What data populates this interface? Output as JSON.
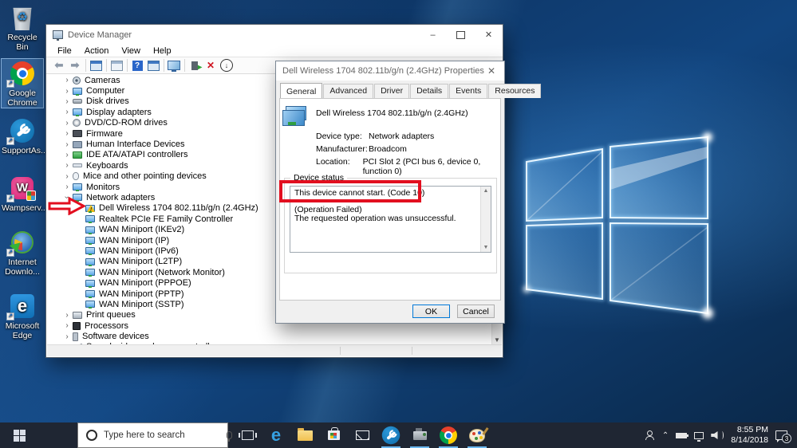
{
  "desktop": {
    "icons": [
      {
        "name": "recycle-bin-icon",
        "label": "Recycle Bin",
        "type": "recycle",
        "sel": "",
        "shortcut": false
      },
      {
        "name": "google-chrome-icon",
        "label": "Google Chrome",
        "type": "chrome",
        "sel": "selected",
        "shortcut": true
      },
      {
        "name": "supportassist-icon",
        "label": "SupportAs...",
        "type": "sa",
        "sel": "",
        "shortcut": true
      },
      {
        "name": "wampserver-icon",
        "label": "Wampserv...",
        "type": "wamp",
        "sel": "",
        "shortcut": true
      },
      {
        "name": "internet-download-manager-icon",
        "label": "Internet Downlo...",
        "type": "idm",
        "sel": "",
        "shortcut": true
      },
      {
        "name": "microsoft-edge-icon",
        "label": "Microsoft Edge",
        "type": "edge",
        "sel": "",
        "shortcut": true
      }
    ]
  },
  "device_manager": {
    "title": "Device Manager",
    "menus": [
      {
        "label": "File"
      },
      {
        "label": "Action"
      },
      {
        "label": "View"
      },
      {
        "label": "Help"
      }
    ],
    "toolbar": [
      {
        "name": "back-icon",
        "type": "tb-back"
      },
      {
        "name": "forward-icon",
        "type": "tb-fwd"
      },
      {
        "name": "toolbar-separator",
        "type": "tb-sep"
      },
      {
        "name": "show-console-tree-icon",
        "type": "tb-win"
      },
      {
        "name": "toolbar-separator",
        "type": "tb-sep"
      },
      {
        "name": "export-list-icon",
        "type": "tb-win2"
      },
      {
        "name": "toolbar-separator",
        "type": "tb-sep"
      },
      {
        "name": "help-icon",
        "type": "tb-help"
      },
      {
        "name": "properties-icon",
        "type": "tb-win"
      },
      {
        "name": "toolbar-separator",
        "type": "tb-sep"
      },
      {
        "name": "scan-for-hardware-changes-icon",
        "type": "tb-monitor"
      },
      {
        "name": "toolbar-separator",
        "type": "tb-sep"
      },
      {
        "name": "update-driver-icon",
        "type": "tb-update"
      },
      {
        "name": "uninstall-device-icon",
        "type": "tb-uninstall"
      },
      {
        "name": "disable-device-icon",
        "type": "tb-disable"
      }
    ],
    "tree": [
      {
        "name": "tree-item-cameras",
        "label": "Cameras",
        "chev": "collapsed",
        "row": "",
        "icon": "camera",
        "warning": false
      },
      {
        "name": "tree-item-computer",
        "label": "Computer",
        "chev": "collapsed",
        "row": "",
        "icon": "mon",
        "warning": false
      },
      {
        "name": "tree-item-disk-drives",
        "label": "Disk drives",
        "chev": "collapsed",
        "row": "",
        "icon": "disk",
        "warning": false
      },
      {
        "name": "tree-item-display-adapters",
        "label": "Display adapters",
        "chev": "collapsed",
        "row": "",
        "icon": "mon",
        "warning": false
      },
      {
        "name": "tree-item-dvd-cd-rom-drives",
        "label": "DVD/CD-ROM drives",
        "chev": "collapsed",
        "row": "",
        "icon": "dvd",
        "warning": false
      },
      {
        "name": "tree-item-firmware",
        "label": "Firmware",
        "chev": "collapsed",
        "row": "",
        "icon": "firmware",
        "warning": false
      },
      {
        "name": "tree-item-human-interface-devices",
        "label": "Human Interface Devices",
        "chev": "collapsed",
        "row": "",
        "icon": "hid",
        "warning": false
      },
      {
        "name": "tree-item-ide-ata-atapi-controllers",
        "label": "IDE ATA/ATAPI controllers",
        "chev": "collapsed",
        "row": "",
        "icon": "ide",
        "warning": false
      },
      {
        "name": "tree-item-keyboards",
        "label": "Keyboards",
        "chev": "collapsed",
        "row": "",
        "icon": "keyboard",
        "warning": false
      },
      {
        "name": "tree-item-mice-and-other-pointing-devices",
        "label": "Mice and other pointing devices",
        "chev": "collapsed",
        "row": "",
        "icon": "mouse",
        "warning": false
      },
      {
        "name": "tree-item-monitors",
        "label": "Monitors",
        "chev": "collapsed",
        "row": "",
        "icon": "mon",
        "warning": false
      },
      {
        "name": "tree-item-network-adapters",
        "label": "Network adapters",
        "chev": "expanded",
        "row": "",
        "icon": "mon",
        "warning": false
      },
      {
        "name": "tree-item-dell-wireless-1704",
        "label": "Dell Wireless 1704 802.11b/g/n (2.4GHz)",
        "chev": "none",
        "row": "child",
        "icon": "mon",
        "warning": true
      },
      {
        "name": "tree-item-realtek-pcie-fe",
        "label": "Realtek PCIe FE Family Controller",
        "chev": "none",
        "row": "child",
        "icon": "mon",
        "warning": false
      },
      {
        "name": "tree-item-wan-miniport-ikev2",
        "label": "WAN Miniport (IKEv2)",
        "chev": "none",
        "row": "child",
        "icon": "mon",
        "warning": false
      },
      {
        "name": "tree-item-wan-miniport-ip",
        "label": "WAN Miniport (IP)",
        "chev": "none",
        "row": "child",
        "icon": "mon",
        "warning": false
      },
      {
        "name": "tree-item-wan-miniport-ipv6",
        "label": "WAN Miniport (IPv6)",
        "chev": "none",
        "row": "child",
        "icon": "mon",
        "warning": false
      },
      {
        "name": "tree-item-wan-miniport-l2tp",
        "label": "WAN Miniport (L2TP)",
        "chev": "none",
        "row": "child",
        "icon": "mon",
        "warning": false
      },
      {
        "name": "tree-item-wan-miniport-network-monitor",
        "label": "WAN Miniport (Network Monitor)",
        "chev": "none",
        "row": "child",
        "icon": "mon",
        "warning": false
      },
      {
        "name": "tree-item-wan-miniport-pppoe",
        "label": "WAN Miniport (PPPOE)",
        "chev": "none",
        "row": "child",
        "icon": "mon",
        "warning": false
      },
      {
        "name": "tree-item-wan-miniport-pptp",
        "label": "WAN Miniport (PPTP)",
        "chev": "none",
        "row": "child",
        "icon": "mon",
        "warning": false
      },
      {
        "name": "tree-item-wan-miniport-sstp",
        "label": "WAN Miniport (SSTP)",
        "chev": "none",
        "row": "child",
        "icon": "mon",
        "warning": false
      },
      {
        "name": "tree-item-print-queues",
        "label": "Print queues",
        "chev": "collapsed",
        "row": "",
        "icon": "print",
        "warning": false
      },
      {
        "name": "tree-item-processors",
        "label": "Processors",
        "chev": "collapsed",
        "row": "",
        "icon": "processor",
        "warning": false
      },
      {
        "name": "tree-item-software-devices",
        "label": "Software devices",
        "chev": "collapsed",
        "row": "",
        "icon": "software",
        "warning": false
      },
      {
        "name": "tree-item-sound-video-and-game-controllers",
        "label": "Sound, video and game controllers",
        "chev": "collapsed",
        "row": "",
        "icon": "sound",
        "warning": false
      }
    ]
  },
  "properties_dialog": {
    "title": "Dell Wireless 1704 802.11b/g/n (2.4GHz) Properties",
    "tabs": [
      {
        "label": "General",
        "state": "active"
      },
      {
        "label": "Advanced",
        "state": ""
      },
      {
        "label": "Driver",
        "state": ""
      },
      {
        "label": "Details",
        "state": ""
      },
      {
        "label": "Events",
        "state": ""
      },
      {
        "label": "Resources",
        "state": ""
      }
    ],
    "device_name": "Dell Wireless 1704 802.11b/g/n (2.4GHz)",
    "fields": [
      {
        "label": "Device type:",
        "value": "Network adapters"
      },
      {
        "label": "Manufacturer:",
        "value": "Broadcom"
      },
      {
        "label": "Location:",
        "value": "PCI Slot 2 (PCI bus 6, device 0, function 0)"
      }
    ],
    "status_group_label": "Device status",
    "status_lines": [
      "This device cannot start. (Code 10)",
      "",
      "(Operation Failed)",
      "The requested operation was unsuccessful."
    ],
    "ok_label": "OK",
    "cancel_label": "Cancel"
  },
  "taskbar": {
    "search": {
      "placeholder": "Type here to search"
    },
    "apps": [
      {
        "name": "task-view-icon",
        "type": "a-tv",
        "open": false
      },
      {
        "name": "edge-taskbar-icon",
        "type": "a-edge",
        "open": false,
        "glyph": "e"
      },
      {
        "name": "file-explorer-icon",
        "type": "a-folder",
        "open": false
      },
      {
        "name": "microsoft-store-icon",
        "type": "a-store",
        "open": false
      },
      {
        "name": "mail-icon",
        "type": "a-mail",
        "open": false
      },
      {
        "name": "supportassist-taskbar-icon",
        "type": "a-sa art-sa",
        "open": true
      },
      {
        "name": "device-manager-taskbar-icon",
        "type": "a-devmgr",
        "open": true
      },
      {
        "name": "chrome-taskbar-icon",
        "type": "a-chrome art-chrome",
        "open": true
      },
      {
        "name": "paint-taskbar-icon",
        "type": "a-paint",
        "open": true
      }
    ],
    "tray": {
      "time": "8:55 PM",
      "date": "8/14/2018",
      "notification_count": "3"
    }
  },
  "colors": {
    "annotation_red": "#e20f1f",
    "accent_blue": "#0078d7",
    "taskbar_bg": "#1f2633",
    "open_app_underline": "#6cb8f0"
  }
}
